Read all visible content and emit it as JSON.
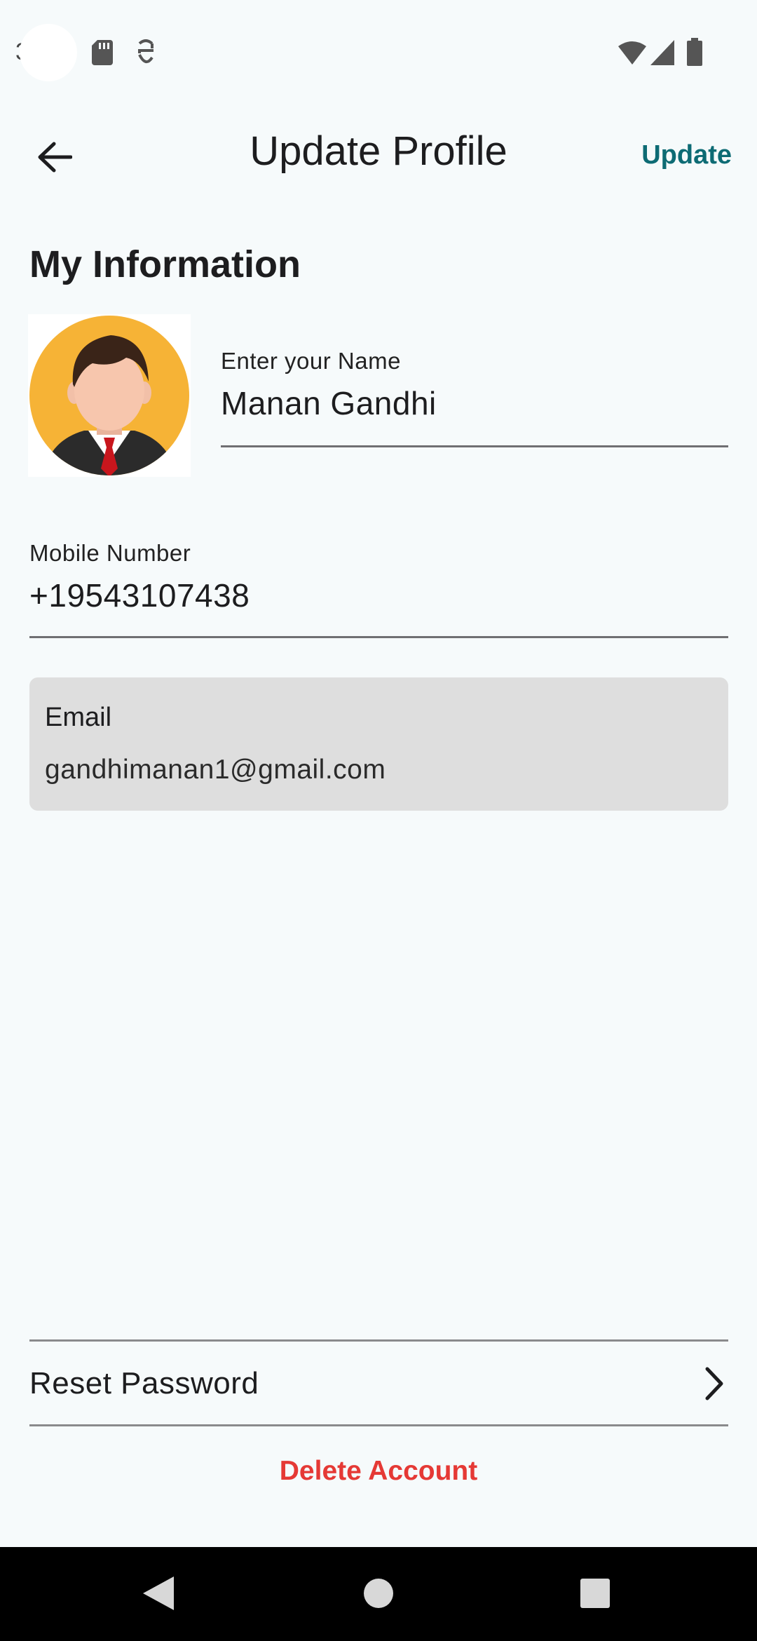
{
  "status_bar": {
    "time_fragment": "3",
    "left_icons": [
      "sd-card-icon",
      "screen-record-icon"
    ],
    "right_icons": [
      "wifi-icon",
      "signal-icon",
      "battery-icon"
    ]
  },
  "app_bar": {
    "title": "Update Profile",
    "action_label": "Update"
  },
  "section": {
    "title": "My Information"
  },
  "name_field": {
    "label": "Enter your Name",
    "value": "Manan Gandhi"
  },
  "mobile_field": {
    "label": "Mobile Number",
    "value": "+19543107438"
  },
  "email_field": {
    "label": "Email",
    "value": "gandhimanan1@gmail.com"
  },
  "reset_password": {
    "label": "Reset Password"
  },
  "delete_account": {
    "label": "Delete Account"
  },
  "colors": {
    "accent": "#0d6b74",
    "danger": "#e53935",
    "background": "#f6fafb",
    "avatar_bg": "#f6b336"
  },
  "nav_bar": {
    "buttons": [
      "back-nav-icon",
      "home-nav-icon",
      "recents-nav-icon"
    ]
  }
}
